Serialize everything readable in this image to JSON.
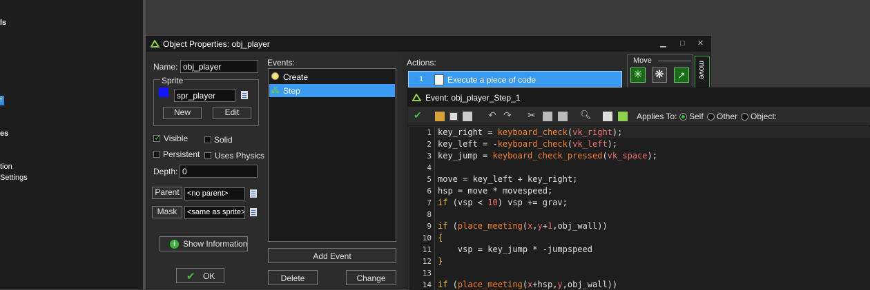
{
  "left_tree": [
    {
      "text": "ls",
      "bold": true
    },
    {
      "text": "f",
      "bold": false
    },
    {
      "text": "es",
      "bold": true
    },
    {
      "text": "tion",
      "bold": false
    },
    {
      "text": "Settings",
      "bold": false
    }
  ],
  "object_window": {
    "title": "Object Properties: obj_player",
    "name_label": "Name:",
    "name_value": "obj_player",
    "sprite_group": "Sprite",
    "sprite_value": "spr_player",
    "new_button": "New",
    "edit_button": "Edit",
    "visible_label": "Visible",
    "solid_label": "Solid",
    "persistent_label": "Persistent",
    "uses_physics_label": "Uses Physics",
    "depth_label": "Depth:",
    "depth_value": "0",
    "parent_button": "Parent",
    "parent_value": "<no parent>",
    "mask_button": "Mask",
    "mask_value": "<same as sprite>",
    "show_info_button": "Show Information",
    "ok_button": "OK",
    "events_label": "Events:",
    "events": [
      "Create",
      "Step"
    ],
    "add_event_button": "Add Event",
    "delete_button": "Delete",
    "change_button": "Change",
    "actions_label": "Actions:",
    "action_number": "1",
    "action_text": "Execute a piece of code",
    "move_group": "Move",
    "move_tab": "move"
  },
  "code_window": {
    "title": "Event: obj_player_Step_1",
    "applies_to_label": "Applies To:",
    "applies_options": [
      "Self",
      "Other",
      "Object:"
    ],
    "line_numbers": [
      "1",
      "2",
      "3",
      "4",
      "5",
      "6",
      "7",
      "8",
      "9",
      "10",
      "11",
      "12",
      "13",
      "14"
    ]
  },
  "colors": {
    "selection": "#3a9af0",
    "keyword": "#f0c045",
    "function": "#f08030",
    "number": "#f07070"
  }
}
